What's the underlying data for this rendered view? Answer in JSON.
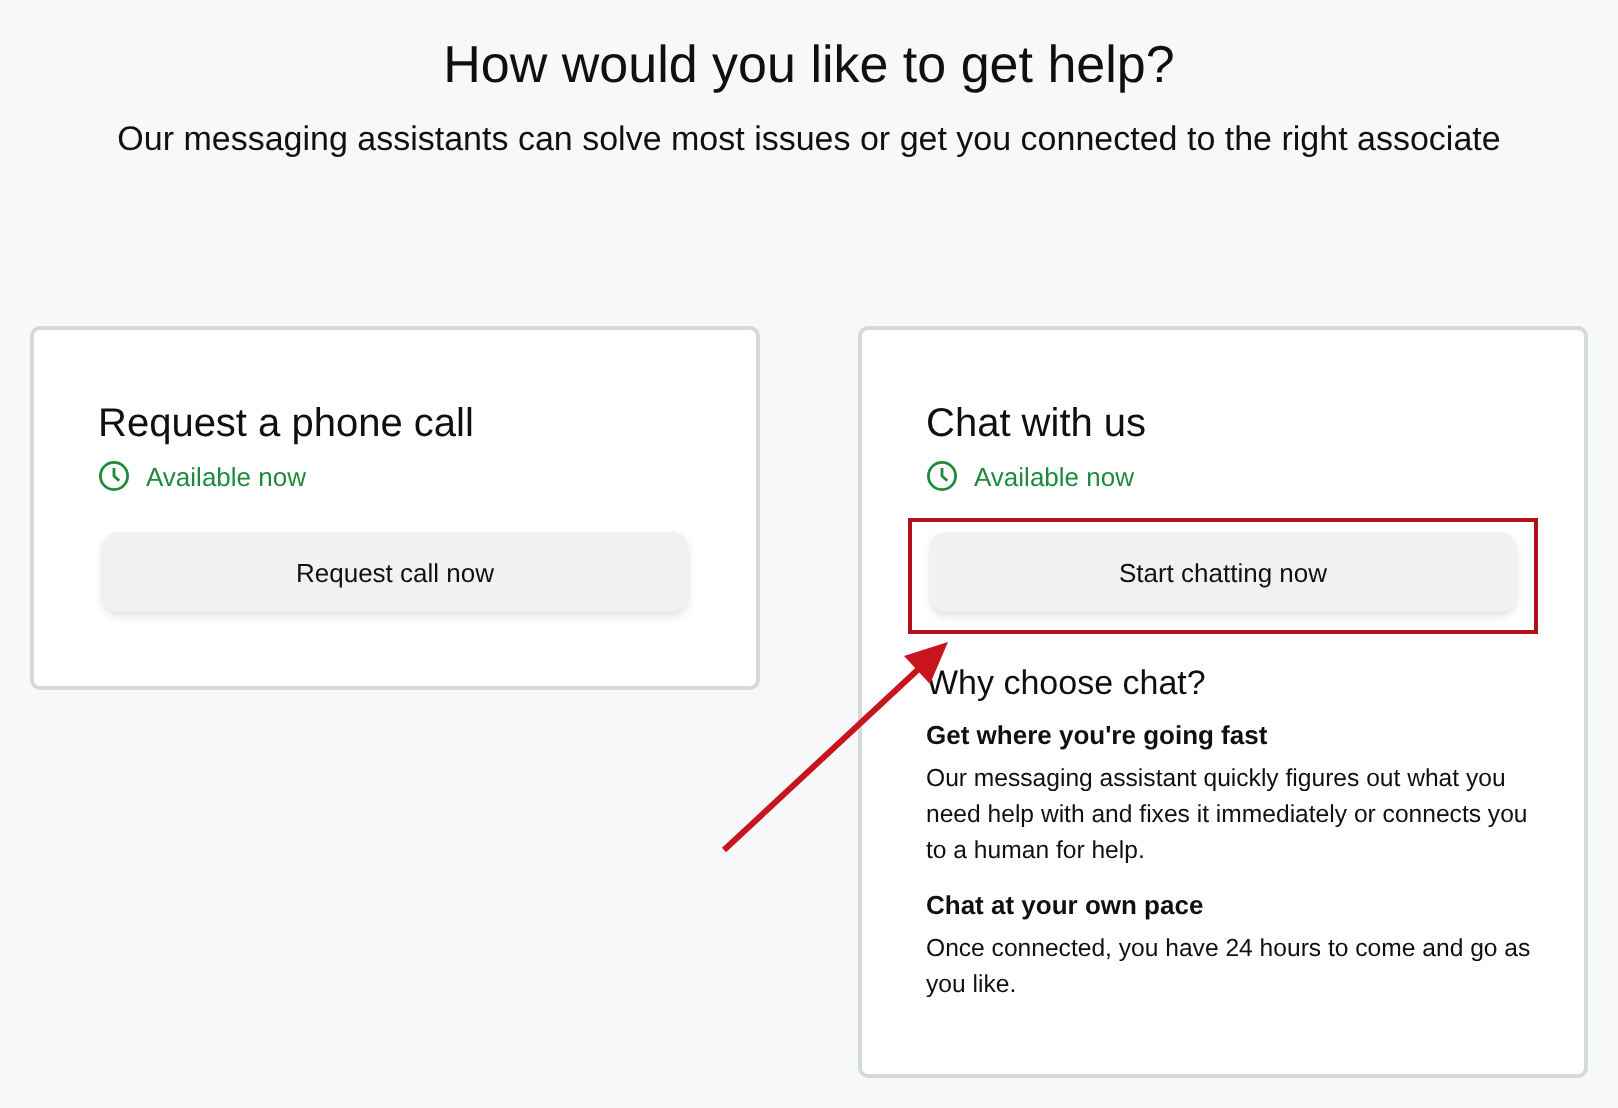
{
  "heading": "How would you like to get help?",
  "subheading": "Our messaging assistants can solve most issues or get you connected to the right associate",
  "options": [
    {
      "title": "Request a phone call",
      "availability": "Available now",
      "button": "Request call now",
      "highlighted": false
    },
    {
      "title": "Chat with us",
      "availability": "Available now",
      "button": "Start chatting now",
      "highlighted": true,
      "why": {
        "title": "Why choose chat?",
        "reasons": [
          {
            "title": "Get where you're going fast",
            "text": "Our messaging assistant quickly figures out what you need help with and fixes it immediately or connects you to a human for help."
          },
          {
            "title": "Chat at your own pace",
            "text": "Once connected, you have 24 hours to come and go as you like."
          }
        ]
      }
    }
  ]
}
